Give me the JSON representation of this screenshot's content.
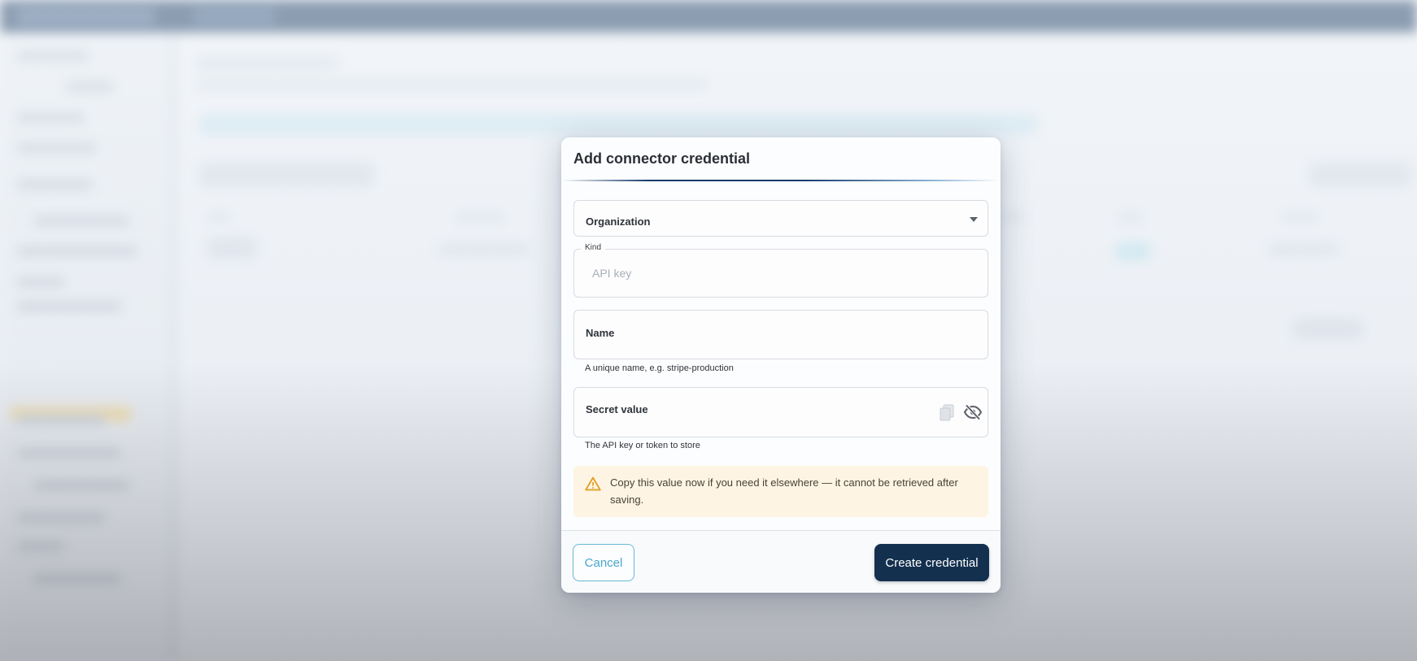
{
  "dialog": {
    "title": "Add connector credential",
    "organization": {
      "label": "Organization"
    },
    "kind": {
      "label": "Kind",
      "value": "API key"
    },
    "name": {
      "label": "Name",
      "helper": "A unique name, e.g. stripe-production"
    },
    "secret": {
      "label": "Secret value",
      "helper": "The API key or token to store"
    },
    "warning": "Copy this value now if you need it elsewhere — it cannot be retrieved after saving.",
    "cancel_label": "Cancel",
    "create_label": "Create credential"
  },
  "icons": {
    "organization_dropdown": "chevron-down-icon",
    "copy": "copy-icon",
    "visibility": "eye-off-icon",
    "warning": "warning-icon"
  },
  "colors": {
    "primary": "#14304f",
    "accent": "#4aa7cc",
    "warning_bg": "#fdf4e4",
    "warning_icon": "#e0a020"
  }
}
